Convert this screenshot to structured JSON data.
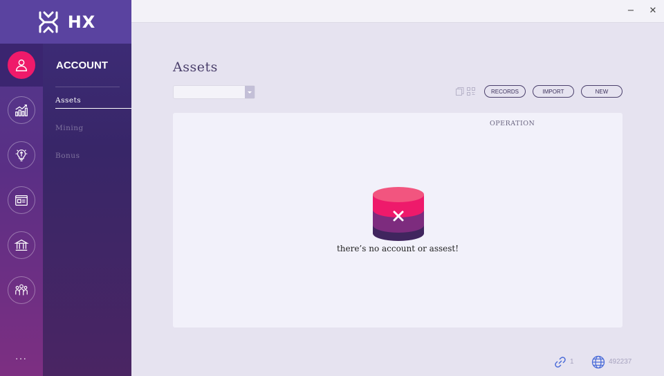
{
  "app": {
    "logo_text": "HX"
  },
  "window": {
    "minimize_glyph": "−",
    "close_glyph": "✕"
  },
  "rail": {
    "items": [
      {
        "icon": "account-icon",
        "active": true
      },
      {
        "icon": "chart-icon"
      },
      {
        "icon": "lightbulb-icon"
      },
      {
        "icon": "id-card-icon"
      },
      {
        "icon": "bank-icon"
      },
      {
        "icon": "community-icon"
      }
    ],
    "more_label": "..."
  },
  "menu": {
    "heading": "ACCOUNT",
    "items": [
      {
        "label": "Assets",
        "active": true
      },
      {
        "label": "Mining"
      },
      {
        "label": "Bonus"
      }
    ]
  },
  "main": {
    "title": "Assets",
    "account_select_value": "",
    "buttons": {
      "records": "RECORDS",
      "import": "IMPORT",
      "new": "NEW"
    },
    "table": {
      "column_header": "OPERATION",
      "empty_message": "there’s no account or assest!"
    }
  },
  "footer": {
    "connections": "1",
    "block_height": "492237"
  },
  "colors": {
    "accent": "#ef1a6a",
    "rail_top": "#4f3a8e",
    "rail_bottom": "#7d2f82",
    "menu_bg": "#382668",
    "content_bg": "#e6e3f0",
    "footer_icon": "#4a6bd8"
  }
}
